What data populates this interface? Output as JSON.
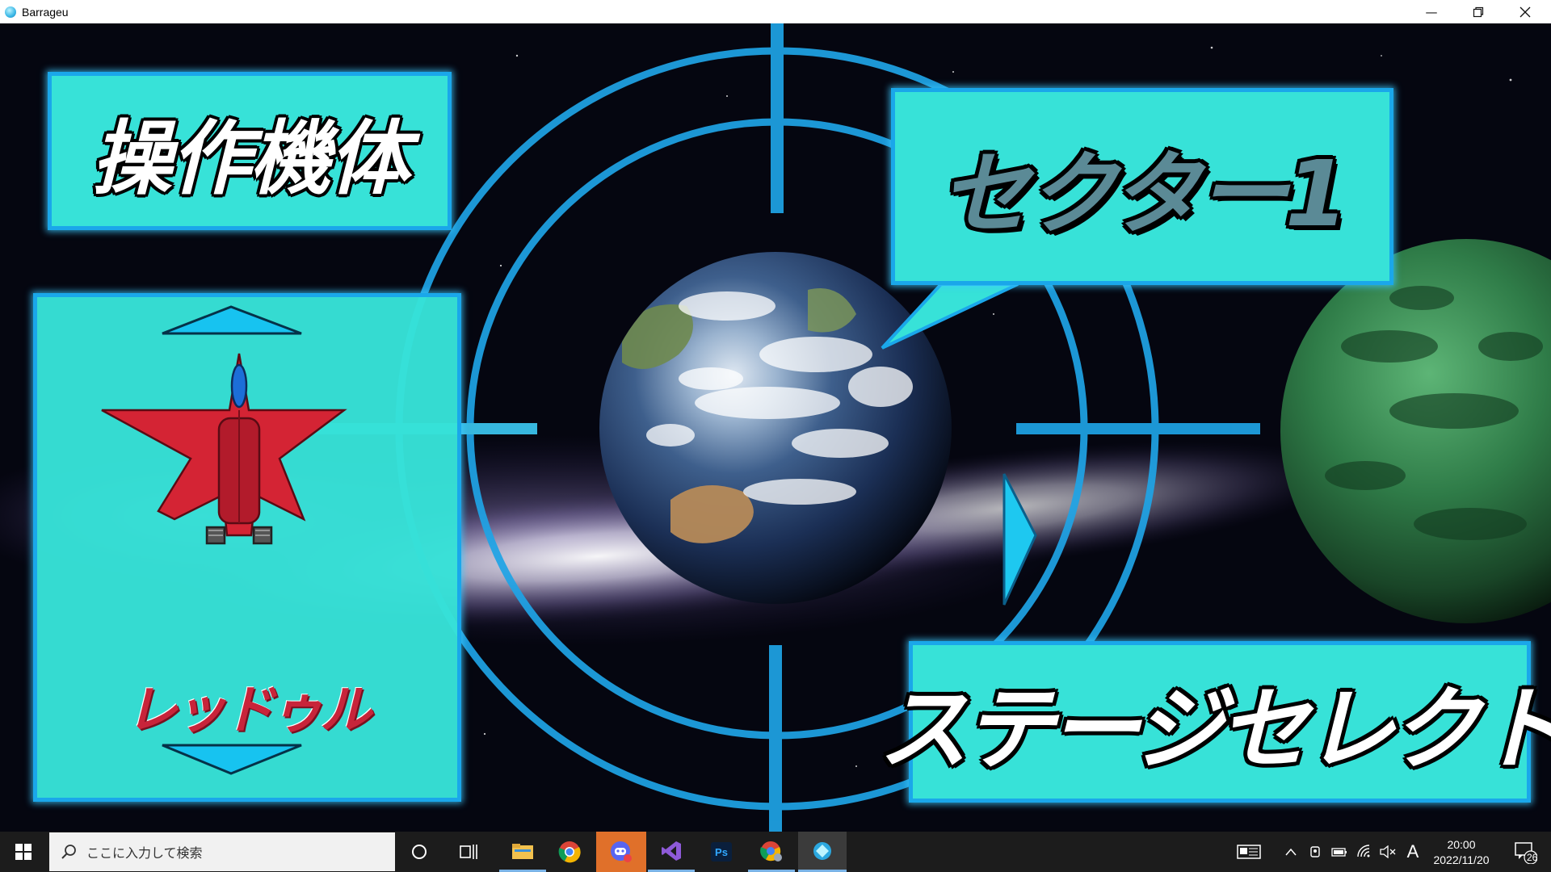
{
  "window": {
    "title": "Barrageu"
  },
  "panels": {
    "operated_ship_heading": "操作機体",
    "ship_name": "レッドゥル",
    "sector_label": "セクター1",
    "stage_select_label": "ステージセレクト"
  },
  "taskbar": {
    "search_placeholder": "ここに入力して検索",
    "apps": [
      "start-icon",
      "search-icon",
      "cortana-icon",
      "task-view-icon",
      "file-explorer-icon",
      "chrome-icon",
      "discord-icon",
      "visual-studio-icon",
      "photoshop-icon",
      "chrome-profile-icon",
      "barrageu-app-icon"
    ],
    "tray": {
      "ime": "A",
      "time": "20:00",
      "date": "2022/11/20",
      "notifications": "26"
    }
  },
  "colors": {
    "panel_fill": "#37e2d8",
    "panel_border": "#1aa7ea",
    "reticle": "#1fa4e6",
    "ship_red": "#d42434"
  }
}
